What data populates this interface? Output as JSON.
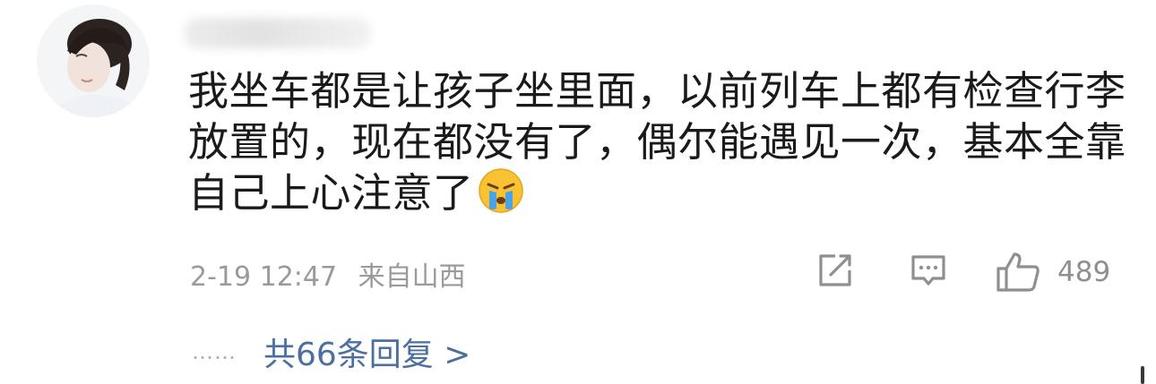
{
  "comment": {
    "username": "",
    "text_lines": [
      "我坐车都是让孩子坐里面，以前列车上都有检查行李",
      "放置的，现在都没有了，偶尔能遇见一次，基本全靠",
      "自己上心注意了"
    ],
    "emoji": "crying-face",
    "time": "2-19 12:47",
    "location": "来自山西",
    "like_count": "489",
    "replies_label": "共66条回复 >",
    "ellipsis": "……"
  },
  "colors": {
    "text": "#1a1a1a",
    "meta": "#9a9a9a",
    "link": "#4a6fa0",
    "icon": "#8f8f8f"
  }
}
